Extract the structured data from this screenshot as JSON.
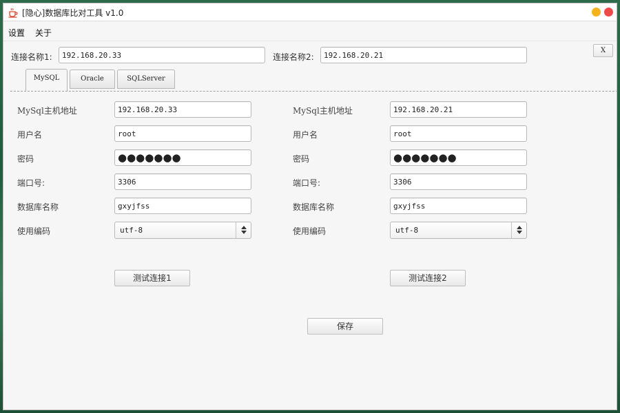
{
  "window": {
    "title": "[隐心]数据库比对工具 v1.0"
  },
  "menu": {
    "settings": "设置",
    "about": "关于"
  },
  "connections": {
    "label1": "连接名称1:",
    "value1": "192.168.20.33",
    "label2": "连接名称2:",
    "value2": "192.168.20.21",
    "close_label": "X"
  },
  "tabs": [
    {
      "label": "MySQL",
      "active": true
    },
    {
      "label": "Oracle",
      "active": false
    },
    {
      "label": "SQLServer",
      "active": false
    }
  ],
  "left": {
    "host_label": "主机地址",
    "host_prefix": "MySql",
    "host": "192.168.20.33",
    "user_label": "用户名",
    "user": "root",
    "password_label": "密码",
    "password": "●●●●●●●",
    "port_label": "端口号:",
    "port": "3306",
    "db_label": "数据库名称",
    "db": "gxyjfss",
    "encoding_label": "使用编码",
    "encoding": "utf-8",
    "test_button": "测试连接1"
  },
  "right": {
    "host_label": "主机地址",
    "host_prefix": "MySql",
    "host": "192.168.20.21",
    "user_label": "用户名",
    "user": "root",
    "password_label": "密码",
    "password": "●●●●●●●",
    "port_label": "端口号:",
    "port": "3306",
    "db_label": "数据库名称",
    "db": "gxyjfss",
    "encoding_label": "使用编码",
    "encoding": "utf-8",
    "test_button": "测试连接2"
  },
  "save_button": "保存",
  "colors": {
    "minimize": "#f5b320",
    "close": "#ee4a4a",
    "icon": "#d9432b"
  },
  "icons": [
    "coffee-cup-icon",
    "minimize-icon",
    "close-icon",
    "spinner-arrows-icon"
  ]
}
